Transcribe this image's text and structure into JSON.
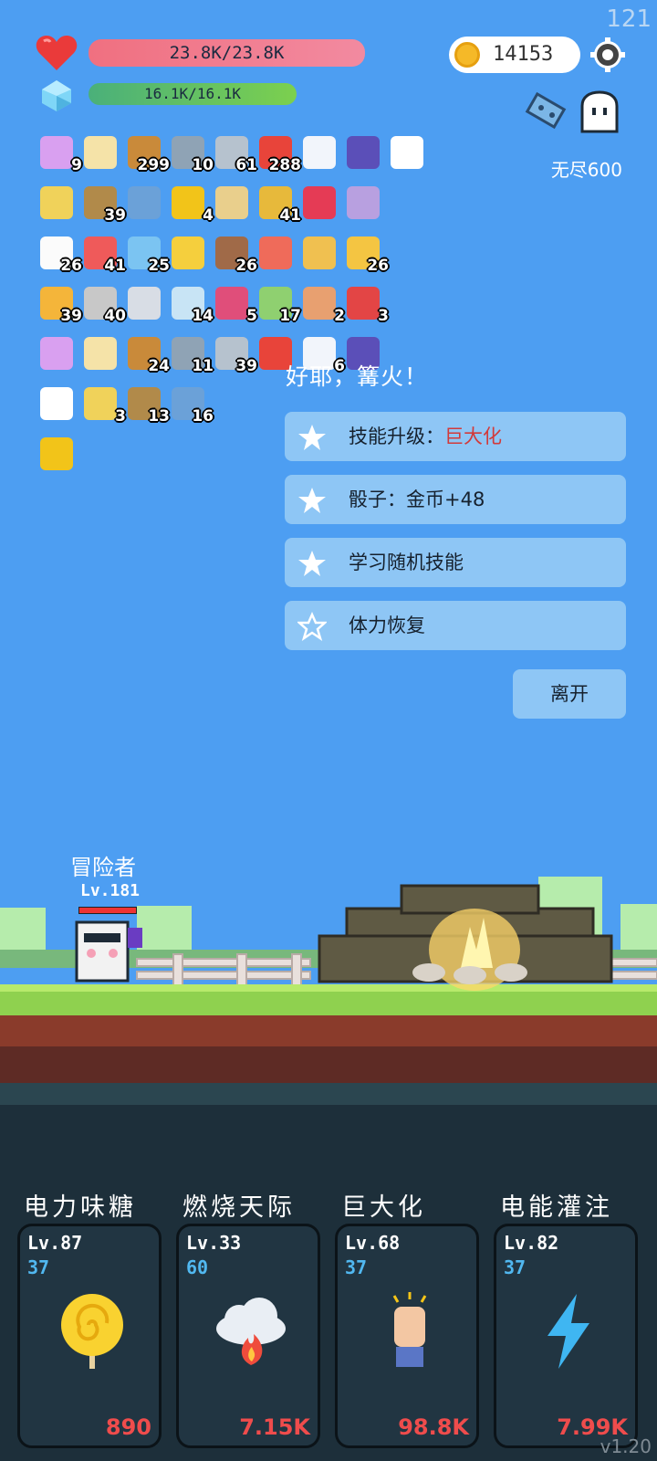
{
  "top_counter": "121",
  "stats": {
    "hp": "23.8K/23.8K",
    "mp": "16.1K/16.1K"
  },
  "currency": {
    "coins": "14153"
  },
  "mode": {
    "label": "无尽600"
  },
  "inventory": {
    "rows": [
      [
        {
          "icon": "flower-pot-icon",
          "count": "9"
        },
        {
          "icon": "map-note-icon",
          "count": ""
        },
        {
          "icon": "book-icon",
          "count": "299"
        },
        {
          "icon": "dagger-icon",
          "count": "10"
        },
        {
          "icon": "sword-icon",
          "count": "61"
        },
        {
          "icon": "apple-icon",
          "count": "288"
        },
        {
          "icon": "speech-bubble-icon",
          "count": ""
        },
        {
          "icon": "wizard-hat-icon",
          "count": ""
        },
        {
          "icon": "collapse-arrow-icon",
          "count": ""
        }
      ],
      [
        {
          "icon": "id-card-icon",
          "count": ""
        },
        {
          "icon": "bow-icon",
          "count": "39"
        },
        {
          "icon": "molecule-icon",
          "count": ""
        },
        {
          "icon": "sunflower-icon",
          "count": "4"
        },
        {
          "icon": "scroll-icon",
          "count": ""
        },
        {
          "icon": "corn-icon",
          "count": "41"
        },
        {
          "icon": "ruby-icon",
          "count": ""
        },
        {
          "icon": "unicorn-icon",
          "count": ""
        }
      ],
      [
        {
          "icon": "daisy-icon",
          "count": "26"
        },
        {
          "icon": "watermelon-icon",
          "count": "41"
        },
        {
          "icon": "chat-icon",
          "count": "25"
        },
        {
          "icon": "magic-wand-icon",
          "count": ""
        },
        {
          "icon": "shield-round-icon",
          "count": "26"
        },
        {
          "icon": "heat-waves-icon",
          "count": ""
        },
        {
          "icon": "beads-icon",
          "count": ""
        },
        {
          "icon": "beer-icon",
          "count": "26"
        }
      ],
      [
        {
          "icon": "pineapple-icon",
          "count": "39"
        },
        {
          "icon": "arrows-icon",
          "count": "40"
        },
        {
          "icon": "compass-icon",
          "count": ""
        },
        {
          "icon": "shirt-icon",
          "count": "14"
        },
        {
          "icon": "jam-jar-icon",
          "count": "5"
        },
        {
          "icon": "potion-flask-icon",
          "count": "17"
        },
        {
          "icon": "briefcase-icon",
          "count": "2"
        },
        {
          "icon": "bookmark-icon",
          "count": "3"
        }
      ],
      [
        {
          "icon": "target-icon",
          "count": ""
        },
        {
          "icon": "ice-cream-icon",
          "count": ""
        },
        {
          "icon": "flag-bottle-icon",
          "count": "24"
        },
        {
          "icon": "thermometer-icon",
          "count": "11"
        },
        {
          "icon": "tombstone-icon",
          "count": "39"
        },
        {
          "icon": "playing-cards-icon",
          "count": ""
        },
        {
          "icon": "syringe-icon",
          "count": "6"
        },
        {
          "icon": "ghost-icon",
          "count": ""
        }
      ],
      [
        {
          "icon": "coconut-icon",
          "count": ""
        },
        {
          "icon": "strawberry-icon",
          "count": "3"
        },
        {
          "icon": "capsule-red-icon",
          "count": "13"
        },
        {
          "icon": "capsule-blue-icon",
          "count": "16"
        }
      ],
      [
        {
          "icon": "lightbulb-tile-icon",
          "count": ""
        }
      ]
    ]
  },
  "event": {
    "title": "好耶，篝火！",
    "options": [
      {
        "prefix": "技能升级：",
        "highlight": "巨大化",
        "filled": true
      },
      {
        "prefix": "骰子：金币+48",
        "highlight": "",
        "filled": true
      },
      {
        "prefix": "学习随机技能",
        "highlight": "",
        "filled": true
      },
      {
        "prefix": "体力恢复",
        "highlight": "",
        "filled": false
      }
    ],
    "leave_label": "离开"
  },
  "player": {
    "name": "冒险者",
    "level": "Lv.181"
  },
  "skills": [
    {
      "name": "电力味糖",
      "level": "Lv.87",
      "cost": "37",
      "price": "890",
      "icon": "lollipop-icon"
    },
    {
      "name": "燃烧天际",
      "level": "Lv.33",
      "cost": "60",
      "price": "7.15K",
      "icon": "fire-cloud-icon"
    },
    {
      "name": "巨大化",
      "level": "Lv.68",
      "cost": "37",
      "price": "98.8K",
      "icon": "raised-fist-icon"
    },
    {
      "name": "电能灌注",
      "level": "Lv.82",
      "cost": "37",
      "price": "7.99K",
      "icon": "lightning-icon"
    }
  ],
  "version": "v1.20",
  "colors": {
    "sky": "#4d9ef2",
    "option_bg": "#8ec6f5",
    "highlight": "#d23a3a",
    "price": "#ef4c4c",
    "cost": "#51b8f0"
  }
}
